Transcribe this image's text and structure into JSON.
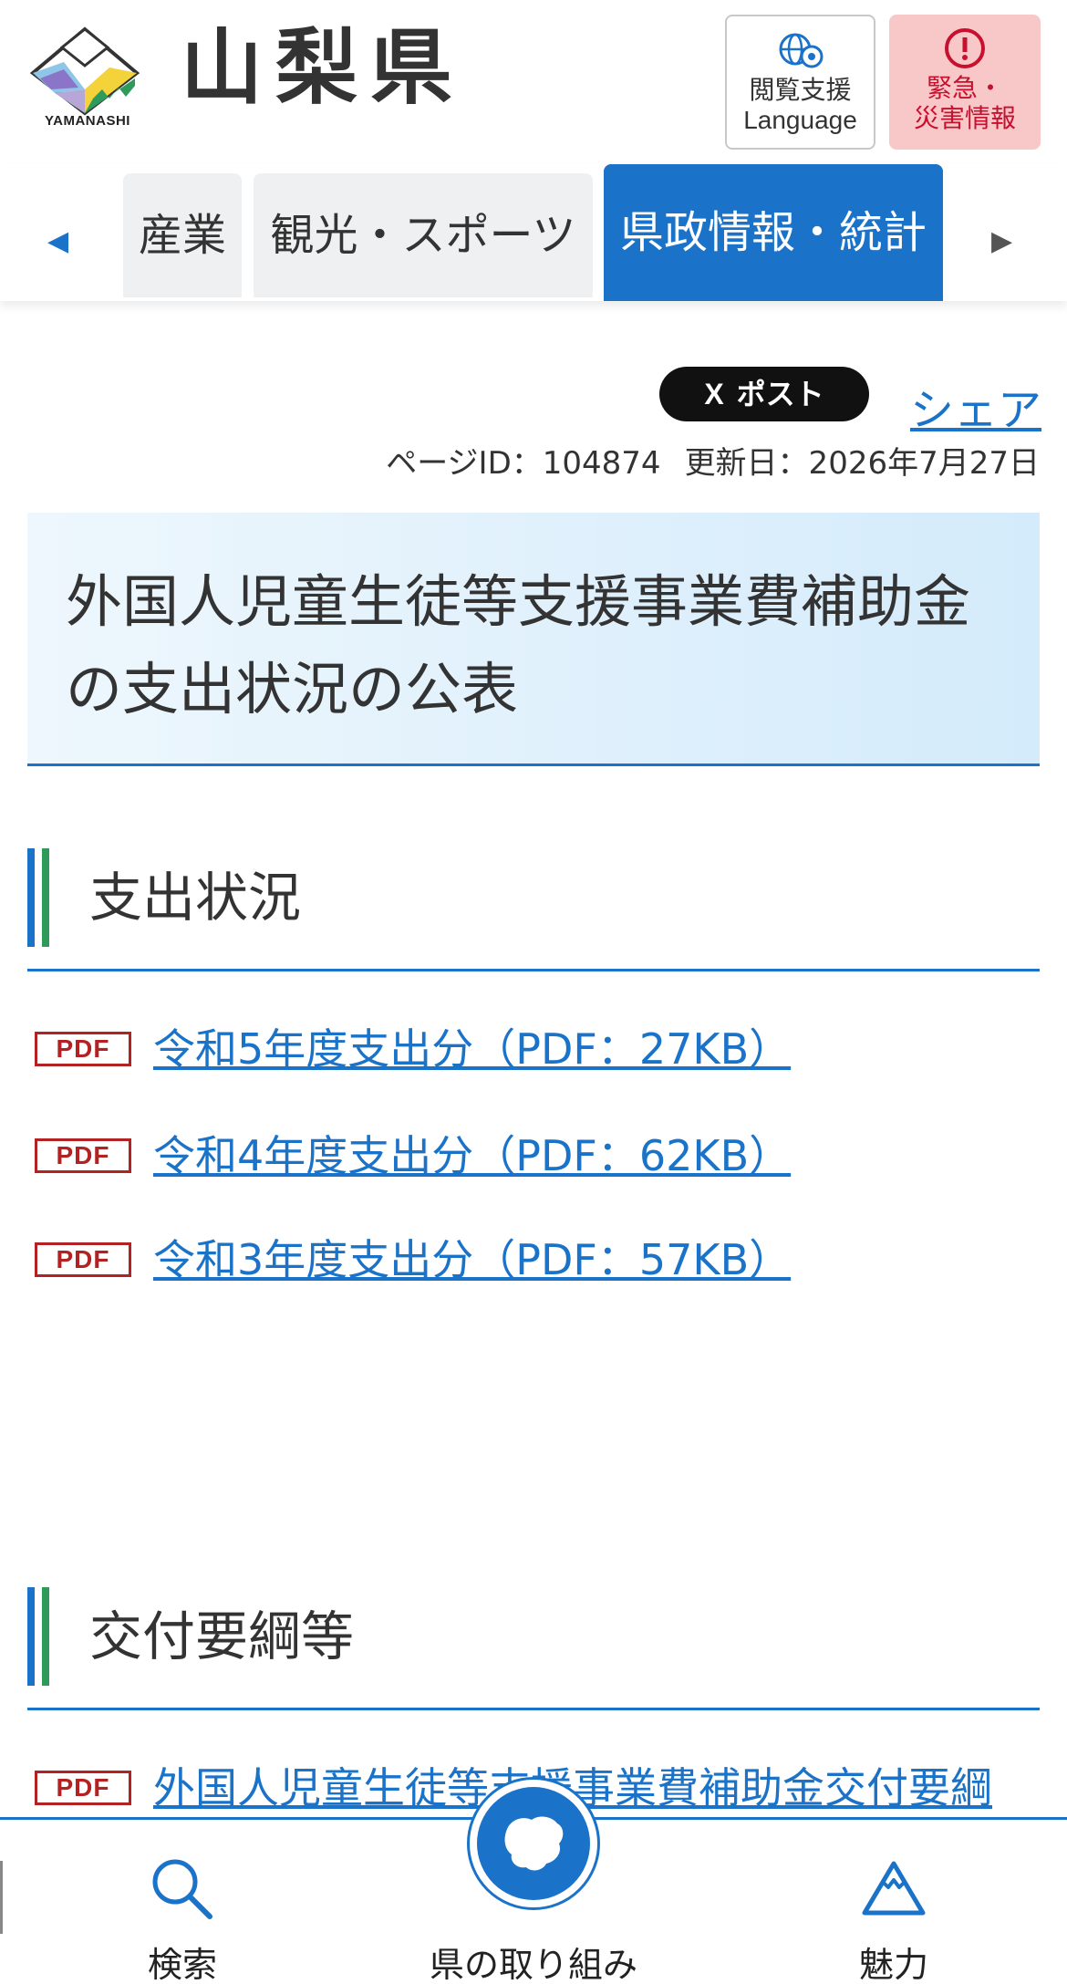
{
  "header": {
    "logo_text": "YAMANASHI",
    "pref_name": "山梨県",
    "lang_button": {
      "line1": "閲覧支援",
      "line2": "Language",
      "icon": "gear-globe-icon"
    },
    "emergency_button": {
      "line1": "緊急・",
      "line2": "災害情報",
      "icon": "alert-circle-icon"
    }
  },
  "nav": {
    "items": [
      {
        "label": "産業"
      },
      {
        "label": "観光・スポーツ"
      },
      {
        "label": "県政情報・統計",
        "active": true
      }
    ],
    "prev_arrow": "◀",
    "next_arrow": "▶"
  },
  "share": {
    "x_glyph": "X",
    "post_label": "ポスト",
    "share_label": "シェア"
  },
  "meta": {
    "page_id": "ページID：104874",
    "updated": "更新日：2026年7月27日"
  },
  "page_title": "外国人児童生徒等支援事業費補助金の支出状況の公表",
  "sections": [
    {
      "heading": "支出状況",
      "links": [
        {
          "badge": "PDF",
          "label": "令和5年度支出分（PDF：27KB）"
        },
        {
          "badge": "PDF",
          "label": "令和4年度支出分（PDF：62KB）"
        },
        {
          "badge": "PDF",
          "label": "令和3年度支出分（PDF：57KB）"
        }
      ]
    },
    {
      "heading": "交付要綱等",
      "links": [
        {
          "badge": "PDF",
          "label": "外国人児童生徒等支援事業費補助金交付要綱"
        }
      ]
    }
  ],
  "bottom_bar": {
    "search_label": "検索",
    "center_label": "県の取り組み",
    "charm_label": "魅力"
  },
  "colors": {
    "primary": "#1a73c8",
    "accent_green": "#2e9b5b",
    "emergency_bg": "#f8c8c8",
    "emergency_text": "#c8102e",
    "pdf_red": "#b22222"
  }
}
